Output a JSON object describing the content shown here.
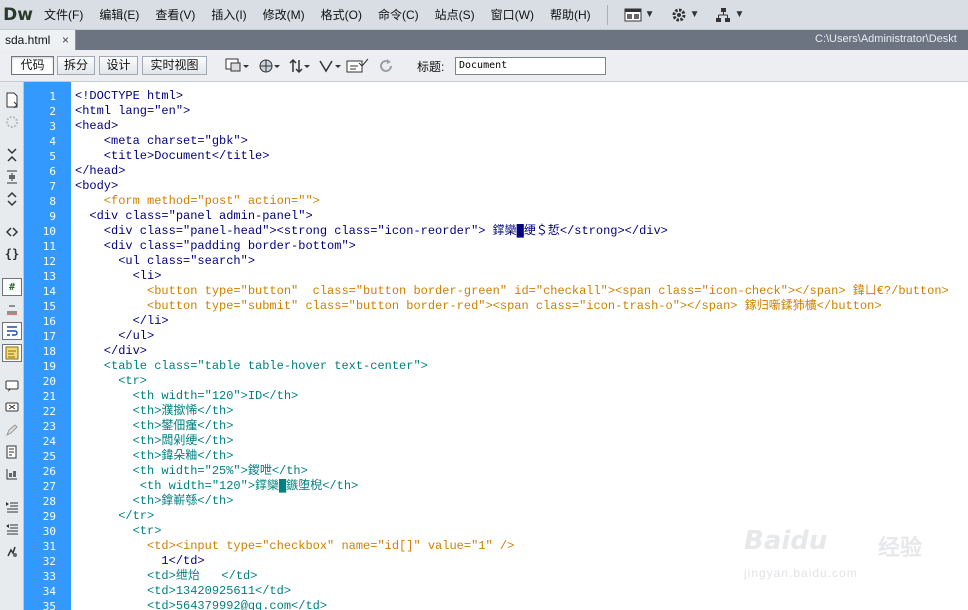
{
  "app": {
    "logo": "Dw"
  },
  "menu": [
    "文件(F)",
    "编辑(E)",
    "查看(V)",
    "插入(I)",
    "修改(M)",
    "格式(O)",
    "命令(C)",
    "站点(S)",
    "窗口(W)",
    "帮助(H)"
  ],
  "toolbar_icons": [
    "layout-icon",
    "gear-icon",
    "sitemap-icon"
  ],
  "tabs": {
    "file": "sda.html",
    "close": "×",
    "path": "C:\\Users\\Administrator\\Deskt"
  },
  "views": [
    "代码",
    "拆分",
    "设计",
    "实时视图"
  ],
  "doc_title": {
    "label": "标题:",
    "value": "Document"
  },
  "code_lines": [
    {
      "n": "1",
      "c": "<!DOCTYPE html>"
    },
    {
      "n": "2",
      "c": "<html lang=\"en\">"
    },
    {
      "n": "3",
      "c": "<head>"
    },
    {
      "n": "4",
      "c": "    <meta charset=\"gbk\">"
    },
    {
      "n": "5",
      "c": "    <title>Document</title>"
    },
    {
      "n": "6",
      "c": "</head>"
    },
    {
      "n": "7",
      "c": "<body>"
    },
    {
      "n": "8",
      "c": "    <form method=\"post\" action=\"\">"
    },
    {
      "n": "9",
      "c": "  <div class=\"panel admin-panel\">"
    },
    {
      "n": "10",
      "c": "    <div class=\"panel-head\"><strong class=\"icon-reorder\"> 鐣欒█绠＄悊</strong></div>"
    },
    {
      "n": "11",
      "c": "    <div class=\"padding border-bottom\">"
    },
    {
      "n": "12",
      "c": "      <ul class=\"search\">"
    },
    {
      "n": "13",
      "c": "        <li>"
    },
    {
      "n": "14",
      "c": "          <button type=\"button\"  class=\"button border-green\" id=\"checkall\"><span class=\"icon-check\"></span> 鍏ㄩ€?/button>"
    },
    {
      "n": "15",
      "c": "          <button type=\"submit\" class=\"button border-red\"><span class=\"icon-trash-o\"></span> 鎵归噺鍒犻櫎</button>"
    },
    {
      "n": "16",
      "c": "        </li>"
    },
    {
      "n": "17",
      "c": "      </ul>"
    },
    {
      "n": "18",
      "c": "    </div>"
    },
    {
      "n": "19",
      "c": "    <table class=\"table table-hover text-center\">"
    },
    {
      "n": "20",
      "c": "      <tr>"
    },
    {
      "n": "21",
      "c": "        <th width=\"120\">ID</th>"
    },
    {
      "n": "22",
      "c": "        <th>濮撳悕</th>"
    },
    {
      "n": "23",
      "c": "        <th>鐢佃瘽</th>"
    },
    {
      "n": "24",
      "c": "        <th>闆剁绠</th>"
    },
    {
      "n": "25",
      "c": "        <th>鍏朵粬</th>"
    },
    {
      "n": "26",
      "c": "        <th width=\"25%\">鍐呭</th>"
    },
    {
      "n": "27",
      "c": "         <th width=\"120\">鐣欒█鏃堕棿</th>"
    },
    {
      "n": "28",
      "c": "        <th>鎿嶄綔</th>"
    },
    {
      "n": "29",
      "c": "      </tr>"
    },
    {
      "n": "30",
      "c": "        <tr>"
    },
    {
      "n": "31",
      "c": "          <td><input type=\"checkbox\" name=\"id[]\" value=\"1\" />"
    },
    {
      "n": "32",
      "c": "            1</td>"
    },
    {
      "n": "33",
      "c": "          <td>绁炲   </td>"
    },
    {
      "n": "34",
      "c": "          <td>13420925611</td>"
    },
    {
      "n": "35",
      "c": "          <td>564379992@qq.com</td>"
    }
  ],
  "watermark": {
    "brand": "Bai",
    "brand2": "du",
    "cn": "经验",
    "sub": "jingyan.baidu.com"
  }
}
